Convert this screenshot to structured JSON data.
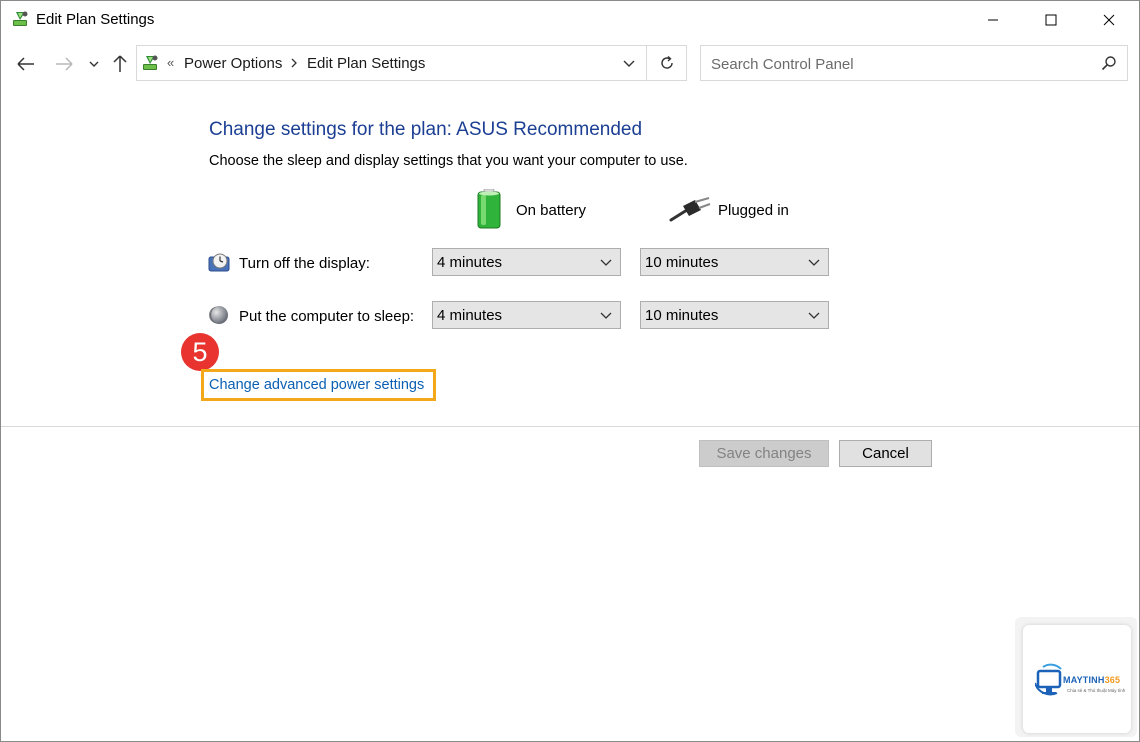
{
  "window": {
    "title": "Edit Plan Settings"
  },
  "address_bar": {
    "overflow_marker": "«",
    "breadcrumbs": [
      "Power Options",
      "Edit Plan Settings"
    ]
  },
  "search": {
    "placeholder": "Search Control Panel"
  },
  "main": {
    "heading": "Change settings for the plan: ASUS Recommended",
    "description": "Choose the sleep and display settings that you want your computer to use.",
    "columns": {
      "on_battery": "On battery",
      "plugged_in": "Plugged in"
    },
    "rows": [
      {
        "label": "Turn off the display:",
        "on_battery": "4 minutes",
        "plugged_in": "10 minutes"
      },
      {
        "label": "Put the computer to sleep:",
        "on_battery": "4 minutes",
        "plugged_in": "10 minutes"
      }
    ],
    "step_badge": "5",
    "advanced_link": "Change advanced power settings"
  },
  "footer": {
    "save_label": "Save changes",
    "cancel_label": "Cancel"
  },
  "watermark": {
    "brand_main": "MAYTINH",
    "brand_num": "365",
    "tagline": "Chia sẻ & Thủ thuật Máy tính"
  },
  "colors": {
    "heading": "#1c3f94",
    "link": "#0b5fb3",
    "highlight_box": "#f3a81b",
    "step_badge": "#e8332e",
    "battery_green": "#2fb33a"
  },
  "icons": {
    "app": "power-plan-icon",
    "back": "back-arrow-icon",
    "forward": "forward-arrow-icon",
    "recent": "chevron-down-icon",
    "up": "up-arrow-icon",
    "refresh": "refresh-icon",
    "search": "search-icon",
    "battery": "battery-icon",
    "plug": "plug-icon",
    "display": "display-timer-icon",
    "sleep": "sleep-moon-icon"
  }
}
